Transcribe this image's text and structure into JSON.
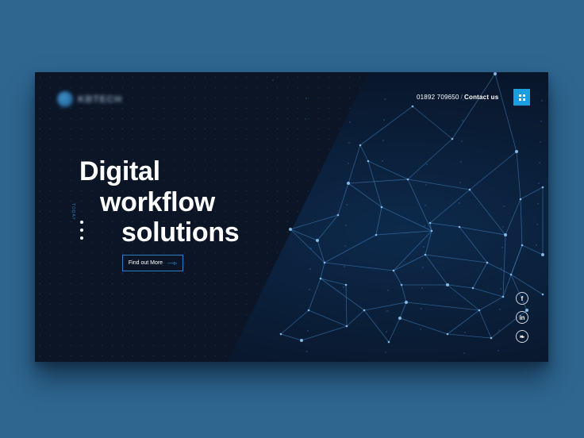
{
  "logo": {
    "text": "KBTECH"
  },
  "header": {
    "phone": "01892 709650",
    "separator": "/",
    "contact_label": "Contact us"
  },
  "hero": {
    "line1": "Digital",
    "line2": "workflow",
    "line3": "solutions",
    "vertical_label": "TODAY",
    "cta_label": "Find out More",
    "cta_arrow": "—▹"
  },
  "social": {
    "facebook": "f",
    "linkedin": "in",
    "twitter": "❧"
  },
  "colors": {
    "background": "#2e6690",
    "card": "#0b1526",
    "accent": "#1a9ee0",
    "network_line": "#4b8fd0"
  }
}
